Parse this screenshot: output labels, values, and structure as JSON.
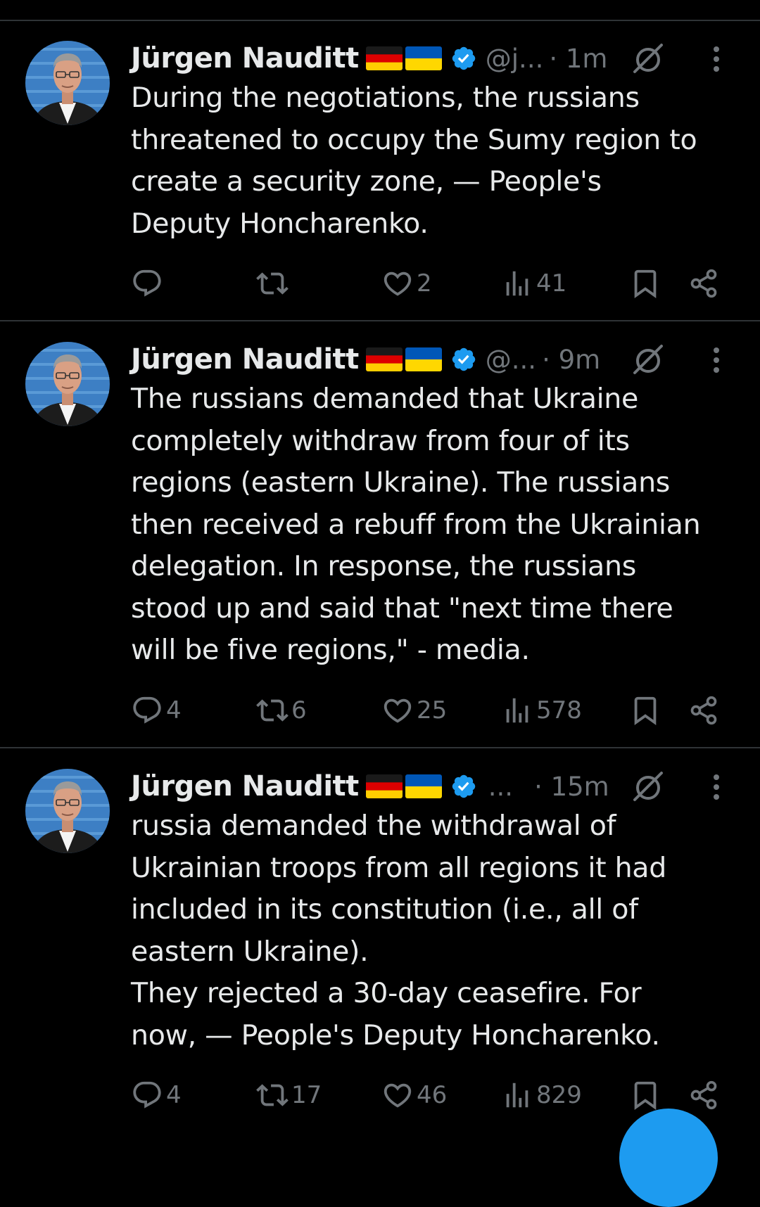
{
  "colors": {
    "background": "#000000",
    "text_primary": "#e7e9ea",
    "text_secondary": "#71767b",
    "divider": "#2f3336",
    "verified": "#1d9bf0",
    "accent": "#1d9bf0"
  },
  "tweets": [
    {
      "author_name": "Jürgen Nauditt",
      "flags": [
        "germany-flag",
        "ukraine-flag"
      ],
      "verified": true,
      "handle": "@j...",
      "time": "· 1m",
      "text": "During the negotiations, the russians\nthreatened to occupy the Sumy region to\ncreate a security zone, — People's\nDeputy Honcharenko.",
      "replies": "",
      "reposts": "",
      "likes": "2",
      "views": "41"
    },
    {
      "author_name": "Jürgen Nauditt",
      "flags": [
        "germany-flag",
        "ukraine-flag"
      ],
      "verified": true,
      "handle": "@...",
      "time": "· 9m",
      "text": "The russians demanded that Ukraine\ncompletely withdraw from four of its\nregions (eastern Ukraine). The russians\nthen received a rebuff from the Ukrainian\ndelegation. In response, the russians\nstood up and said that \"next time there\nwill be five regions,\" - media.",
      "replies": "4",
      "reposts": "6",
      "likes": "25",
      "views": "578"
    },
    {
      "author_name": "Jürgen Nauditt",
      "flags": [
        "germany-flag",
        "ukraine-flag"
      ],
      "verified": true,
      "handle": "...",
      "time": "· 15m",
      "text": "russia demanded the withdrawal of\nUkrainian troops from all regions it had\nincluded in its constitution (i.e., all of\neastern Ukraine).\nThey rejected a 30-day ceasefire. For\nnow, — People's Deputy Honcharenko.",
      "replies": "4",
      "reposts": "17",
      "likes": "46",
      "views": "829"
    }
  ]
}
